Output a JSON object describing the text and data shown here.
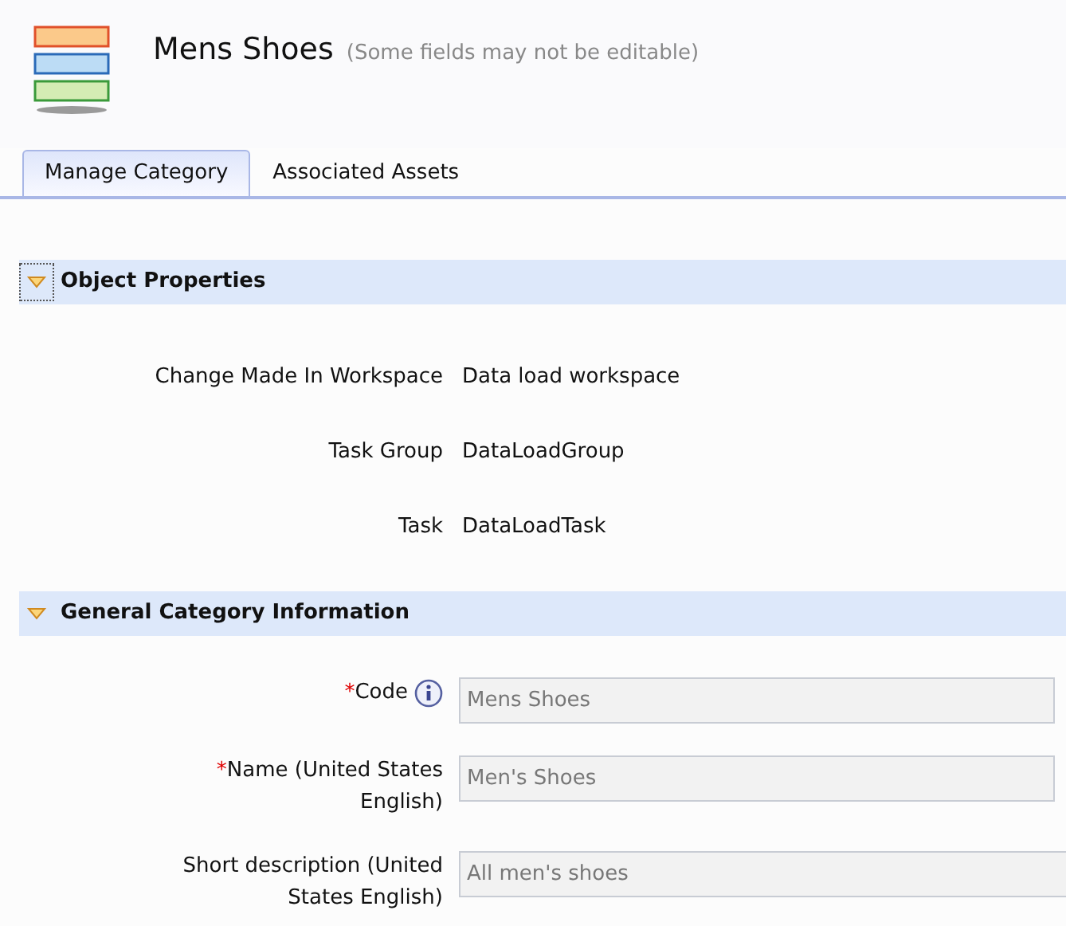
{
  "header": {
    "title": "Mens Shoes",
    "note": "(Some fields may not be editable)"
  },
  "tabs": [
    {
      "label": "Manage Category",
      "selected": true
    },
    {
      "label": "Associated Assets",
      "selected": false
    }
  ],
  "sections": [
    {
      "title": "Object Properties",
      "expanded": true,
      "focused": true,
      "rows": [
        {
          "kind": "text",
          "label": "Change Made In Workspace",
          "value": "Data load workspace"
        },
        {
          "kind": "text",
          "label": "Task Group",
          "value": "DataLoadGroup"
        },
        {
          "kind": "text",
          "label": "Task",
          "value": "DataLoadTask"
        }
      ]
    },
    {
      "title": "General Category Information",
      "expanded": true,
      "focused": false,
      "rows": [
        {
          "kind": "field",
          "required_mark": "*",
          "label": "Code",
          "info": true,
          "value": "Mens Shoes",
          "disabled": true,
          "wide": false
        },
        {
          "kind": "field",
          "required_mark": "*",
          "label": "Name (United States English)",
          "info": false,
          "value": "Men's Shoes",
          "disabled": true,
          "wide": false
        },
        {
          "kind": "field",
          "label": "Short description (United States English)",
          "info": false,
          "value": "All men's shoes",
          "disabled": true,
          "wide": true
        }
      ]
    }
  ]
}
